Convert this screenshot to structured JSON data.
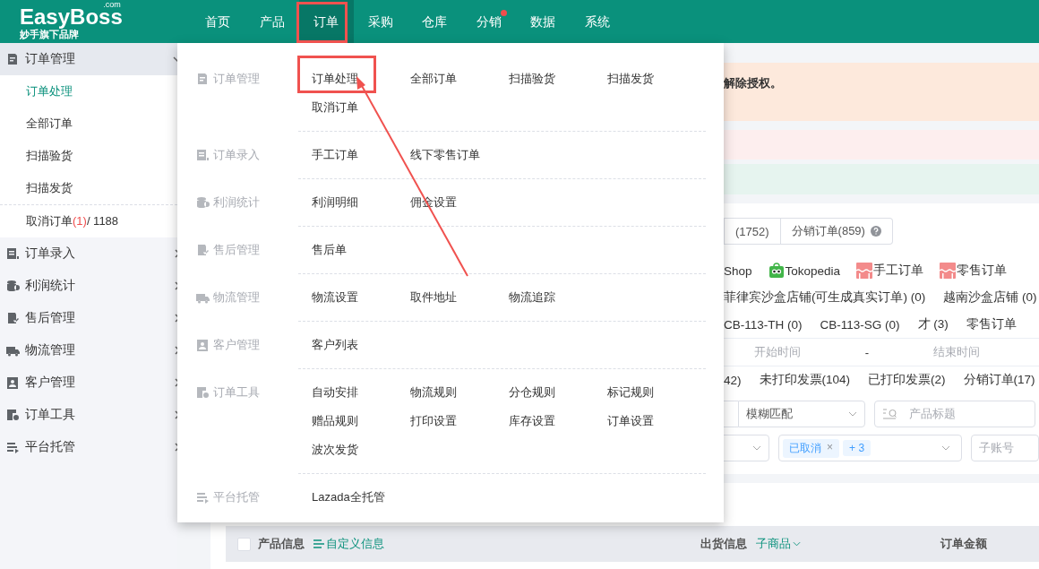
{
  "top_nav": {
    "logo": "EasyBoss",
    "logo_suffix": ".com",
    "tagline": "妙手旗下品牌",
    "items": [
      {
        "label": "首页",
        "selected": false,
        "badge": false
      },
      {
        "label": "产品",
        "selected": false,
        "badge": false
      },
      {
        "label": "订单",
        "selected": true,
        "badge": false
      },
      {
        "label": "采购",
        "selected": false,
        "badge": false
      },
      {
        "label": "仓库",
        "selected": false,
        "badge": false
      },
      {
        "label": "分销",
        "selected": false,
        "badge": true
      },
      {
        "label": "数据",
        "selected": false,
        "badge": false
      },
      {
        "label": "系统",
        "selected": false,
        "badge": false
      }
    ]
  },
  "sidebar": {
    "groups": [
      {
        "kind": "order",
        "label": "订单管理",
        "expanded": true,
        "children": [
          {
            "label": "订单处理",
            "selected": true,
            "separated": false
          },
          {
            "label": "全部订单",
            "selected": false,
            "separated": false
          },
          {
            "label": "扫描验货",
            "selected": false,
            "separated": false
          },
          {
            "label": "扫描发货",
            "selected": false,
            "separated": false
          },
          {
            "label": "取消订单",
            "selected": false,
            "separated": true,
            "count": "(1)",
            "total": "/ 1188"
          }
        ]
      },
      {
        "kind": "entry",
        "label": "订单录入",
        "expanded": false
      },
      {
        "kind": "profit",
        "label": "利润统计",
        "expanded": false
      },
      {
        "kind": "aftersale",
        "label": "售后管理",
        "expanded": false
      },
      {
        "kind": "logistics",
        "label": "物流管理",
        "expanded": false
      },
      {
        "kind": "customer",
        "label": "客户管理",
        "expanded": false
      },
      {
        "kind": "tools",
        "label": "订单工具",
        "expanded": false
      },
      {
        "kind": "hosting",
        "label": "平台托管",
        "expanded": false
      }
    ]
  },
  "dropdown_menu": {
    "categories": [
      {
        "kind": "order",
        "label": "订单管理",
        "items": [
          "订单处理",
          "全部订单",
          "扫描验货",
          "扫描发货",
          "取消订单"
        ]
      },
      {
        "kind": "entry",
        "label": "订单录入",
        "items": [
          "手工订单",
          "线下零售订单"
        ]
      },
      {
        "kind": "profit",
        "label": "利润统计",
        "items": [
          "利润明细",
          "佣金设置"
        ]
      },
      {
        "kind": "aftersale",
        "label": "售后管理",
        "items": [
          "售后单"
        ]
      },
      {
        "kind": "logistics",
        "label": "物流管理",
        "items": [
          "物流设置",
          "取件地址",
          "物流追踪"
        ]
      },
      {
        "kind": "customer",
        "label": "客户管理",
        "items": [
          "客户列表"
        ]
      },
      {
        "kind": "tools",
        "label": "订单工具",
        "items": [
          "自动安排",
          "物流规则",
          "分仓规则",
          "标记规则",
          "赠品规则",
          "打印设置",
          "库存设置",
          "订单设置",
          "波次发货"
        ]
      },
      {
        "kind": "hosting",
        "label": "平台托管",
        "items": [
          "Lazada全托管"
        ]
      }
    ]
  },
  "banners": [
    {
      "kind": "warning",
      "text": "解除授权。"
    },
    {
      "kind": "error"
    },
    {
      "kind": "success"
    }
  ],
  "order_tabs": [
    {
      "label": "(1752)",
      "help": false
    },
    {
      "label": "分销订单(859)",
      "help": true
    }
  ],
  "platforms": [
    {
      "kind": "plain",
      "label": "Shop"
    },
    {
      "kind": "tokopedia",
      "label": "Tokopedia"
    },
    {
      "kind": "manual",
      "label": "手工订单"
    },
    {
      "kind": "manual",
      "label": "零售订单"
    }
  ],
  "store_rows": [
    [
      "菲律宾沙盒店铺(可生成真实订单) (0)",
      "越南沙盒店铺 (0)"
    ],
    [
      "CB-113-TH (0)",
      "CB-113-SG (0)",
      "才 (3)",
      "零售订单"
    ]
  ],
  "date_range": {
    "start_placeholder": "开始时间",
    "separator": "-",
    "end_placeholder": "结束时间"
  },
  "print_filters": [
    "42)",
    "未打印发票(104)",
    "已打印发票(2)",
    "分销订单(17)"
  ],
  "search_row": {
    "match_select": "模糊匹配",
    "search_placeholder": "产品标题"
  },
  "status_row": {
    "tags": [
      "已取消"
    ],
    "remove_icon": "×",
    "more": "+ 3",
    "account_placeholder": "子账号"
  },
  "table": {
    "select_all_checked": false,
    "product_column": "产品信息",
    "custom_link": "自定义信息",
    "shipping_column": "出货信息",
    "sub_item_select": "子商品",
    "amount_column": "订单金额"
  }
}
